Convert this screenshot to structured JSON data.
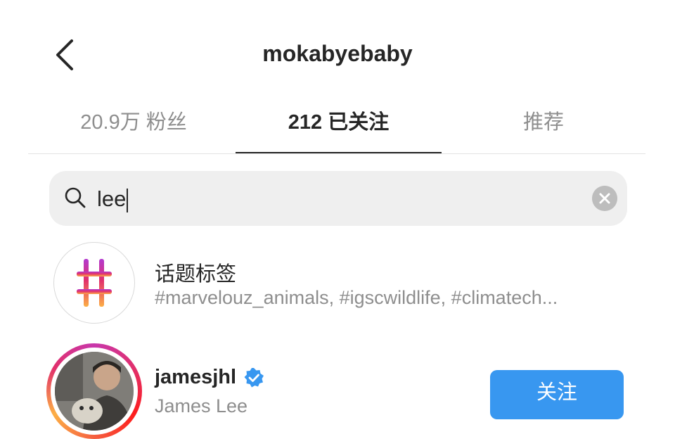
{
  "header": {
    "back_icon": "chevron-left-icon",
    "title": "mokabyebaby"
  },
  "tabs": [
    {
      "label": "20.9万 粉丝",
      "active": false
    },
    {
      "label": "212 已关注",
      "active": true
    },
    {
      "label": "推荐",
      "active": false
    }
  ],
  "search": {
    "icon": "search-icon",
    "value": "lee",
    "clear_icon": "clear-circle-icon"
  },
  "results": {
    "hashtags": {
      "icon": "hashtag-icon",
      "title": "话题标签",
      "subtitle": "#marvelouz_animals, #igscwildlife, #climatech..."
    },
    "user": {
      "username": "jamesjhl",
      "verified_icon": "verified-badge-icon",
      "full_name": "James Lee",
      "follow_label": "关注"
    }
  },
  "colors": {
    "text_primary": "#262626",
    "text_secondary": "#8e8e8e",
    "search_bg": "#efefef",
    "follow_button": "#3897f0",
    "verified": "#3897f0"
  }
}
